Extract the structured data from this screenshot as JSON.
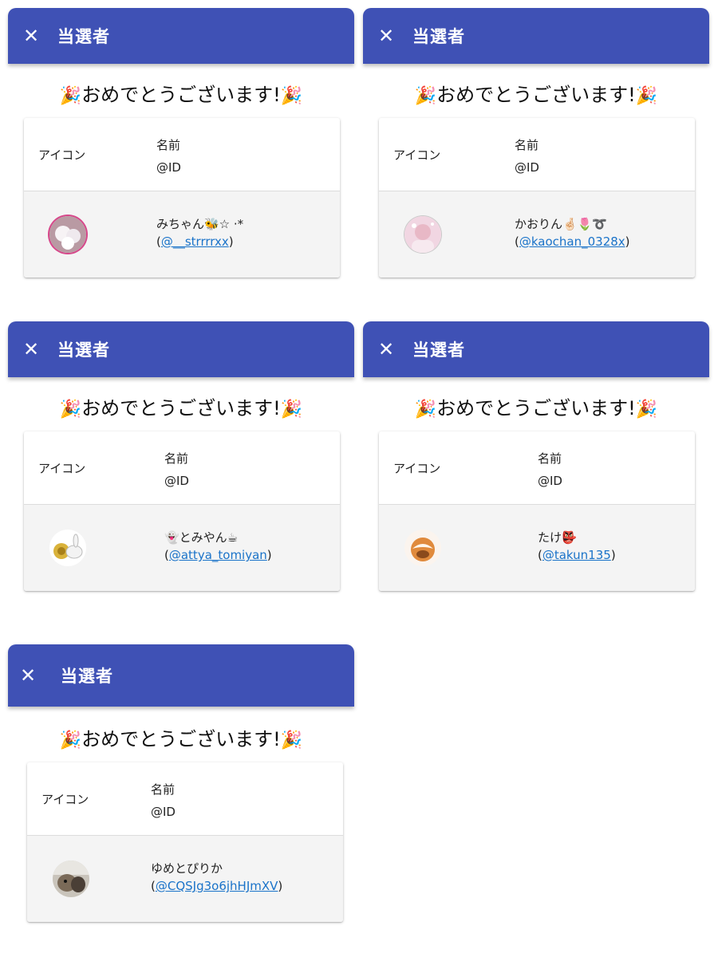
{
  "colors": {
    "appbar": "#3f51b5",
    "link": "#1a73c9",
    "row_bg": "#f4f4f4"
  },
  "icons": {
    "close": "close-icon",
    "party": "party-popper-icon"
  },
  "common": {
    "close_glyph": "✕",
    "title": "当選者",
    "congrats_emoji": "🎉",
    "congrats_text": "おめでとうございます!",
    "col_icon": "アイコン",
    "col_name": "名前",
    "col_id": "@ID",
    "paren_open": "(",
    "paren_close": ")"
  },
  "winners": [
    {
      "name": "みちゃん🐝☆",
      "name_suffix": "·*",
      "handle": "@__strrrrxx",
      "avatar": "cartoon-character-avatar"
    },
    {
      "name": "かおりん",
      "name_suffix": "🌷➰",
      "handle": "@kaochan_0328x",
      "avatar": "pink-portrait-avatar"
    },
    {
      "name": "👻とみやん☕",
      "name_suffix": "",
      "handle": "@attya_tomiyan",
      "avatar": "snail-rabbit-avatar"
    },
    {
      "name": "たけ👺",
      "name_suffix": "",
      "handle": "@takun135",
      "avatar": "orange-character-avatar"
    },
    {
      "name": "ゆめとぴりか",
      "name_suffix": "",
      "handle": "@CQSJg3o6jhHJmXV",
      "avatar": "photo-avatar"
    }
  ]
}
